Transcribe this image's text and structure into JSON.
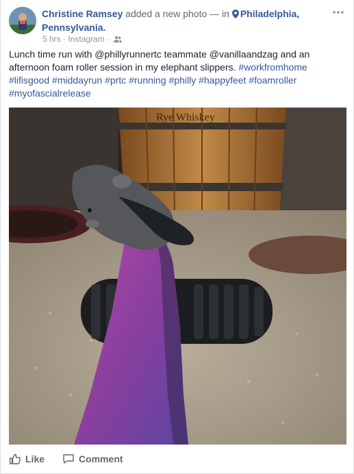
{
  "post": {
    "author": "Christine Ramsey",
    "action_text": " added a new photo — in ",
    "location": "Philadelphia, Pennsylvania.",
    "timestamp": "5 hrs",
    "source": "Instagram",
    "separator": " · ",
    "privacy_icon": "friends-icon",
    "text_segments": [
      {
        "text": "Lunch time run with @phillyrunnertc teammate @vanillaandzag and an afternoon foam roller session in my elephant slippers. ",
        "tag": false
      },
      {
        "text": "#workfromhome",
        "tag": true
      },
      {
        "text": " ",
        "tag": false
      },
      {
        "text": "#lifisgood",
        "tag": true
      },
      {
        "text": " ",
        "tag": false
      },
      {
        "text": "#middayrun",
        "tag": true
      },
      {
        "text": " ",
        "tag": false
      },
      {
        "text": "#prtc",
        "tag": true
      },
      {
        "text": " ",
        "tag": false
      },
      {
        "text": "#running",
        "tag": true
      },
      {
        "text": " ",
        "tag": false
      },
      {
        "text": "#philly",
        "tag": true
      },
      {
        "text": " ",
        "tag": false
      },
      {
        "text": "#happyfeet",
        "tag": true
      },
      {
        "text": " ",
        "tag": false
      },
      {
        "text": "#foamroller",
        "tag": true
      },
      {
        "text": " ",
        "tag": false
      },
      {
        "text": "#myofascialrelease",
        "tag": true
      }
    ],
    "photo": {
      "barrel_text": "Rye Whiskey",
      "icon": "photo"
    }
  },
  "actions": {
    "like_label": "Like",
    "comment_label": "Comment"
  },
  "colors": {
    "link": "#365899",
    "text": "#1d2129",
    "secondary": "#90949c",
    "action": "#606770"
  }
}
